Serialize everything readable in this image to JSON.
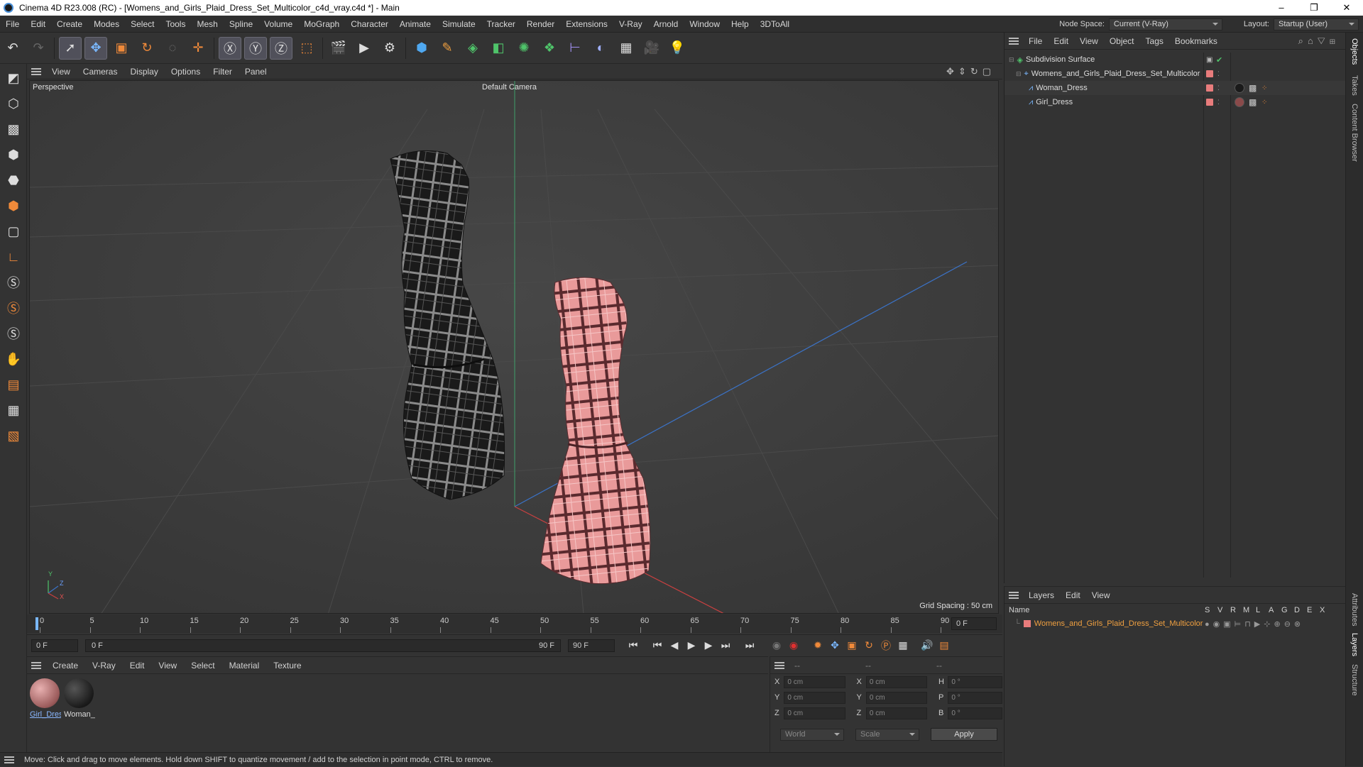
{
  "window": {
    "title": "Cinema 4D R23.008 (RC) - [Womens_and_Girls_Plaid_Dress_Set_Multicolor_c4d_vray.c4d *] - Main",
    "controls": [
      "–",
      "❐",
      "✕"
    ]
  },
  "menubar": {
    "items": [
      "File",
      "Edit",
      "Create",
      "Modes",
      "Select",
      "Tools",
      "Mesh",
      "Spline",
      "Volume",
      "MoGraph",
      "Character",
      "Animate",
      "Simulate",
      "Tracker",
      "Render",
      "Extensions",
      "V-Ray",
      "Arnold",
      "Window",
      "Help",
      "3DToAll"
    ],
    "node_space_label": "Node Space:",
    "node_space_value": "Current (V-Ray)",
    "layout_label": "Layout:",
    "layout_value": "Startup (User)"
  },
  "viewport_menu": {
    "items": [
      "View",
      "Cameras",
      "Display",
      "Options",
      "Filter",
      "Panel"
    ]
  },
  "viewport": {
    "view_name": "Perspective",
    "camera": "Default Camera",
    "grid_spacing": "Grid Spacing : 50 cm",
    "axis_x": "X",
    "axis_y": "Y",
    "axis_z": "Z"
  },
  "timeline": {
    "ticks": [
      "0",
      "5",
      "10",
      "15",
      "20",
      "25",
      "30",
      "35",
      "40",
      "45",
      "50",
      "55",
      "60",
      "65",
      "70",
      "75",
      "80",
      "85",
      "90"
    ],
    "current_frame": "0 F"
  },
  "transport": {
    "start_field": "0 F",
    "range_start": "0 F",
    "range_end": "90 F",
    "end_field": "90 F"
  },
  "material_panel": {
    "menu": [
      "Create",
      "V-Ray",
      "Edit",
      "View",
      "Select",
      "Material",
      "Texture"
    ],
    "materials": [
      {
        "label": "Girl_Dres",
        "color": "#c98a8a"
      },
      {
        "label": "Woman_",
        "color": "#1c1c1c"
      }
    ]
  },
  "coords": {
    "header": [
      "--",
      "--",
      "--"
    ],
    "rows": [
      {
        "l1": "X",
        "v1": "0 cm",
        "l2": "X",
        "v2": "0 cm",
        "l3": "H",
        "v3": "0 °"
      },
      {
        "l1": "Y",
        "v1": "0 cm",
        "l2": "Y",
        "v2": "0 cm",
        "l3": "P",
        "v3": "0 °"
      },
      {
        "l1": "Z",
        "v1": "0 cm",
        "l2": "Z",
        "v2": "0 cm",
        "l3": "B",
        "v3": "0 °"
      }
    ],
    "coord_system": "World",
    "mode": "Scale",
    "apply_label": "Apply"
  },
  "status": {
    "text": "Move: Click and drag to move elements. Hold down SHIFT to quantize movement / add to the selection in point mode, CTRL to remove."
  },
  "object_manager": {
    "menu": [
      "File",
      "Edit",
      "View",
      "Object",
      "Tags",
      "Bookmarks"
    ],
    "objects": [
      {
        "name": "Subdivision Surface",
        "indent": 0
      },
      {
        "name": "Womens_and_Girls_Plaid_Dress_Set_Multicolor",
        "indent": 1
      },
      {
        "name": "Woman_Dress",
        "indent": 2
      },
      {
        "name": "Girl_Dress",
        "indent": 2
      }
    ]
  },
  "layers": {
    "menu": [
      "Layers",
      "Edit",
      "View"
    ],
    "columns": [
      "Name",
      "S",
      "V",
      "R",
      "M",
      "L",
      "A",
      "G",
      "D",
      "E",
      "X"
    ],
    "items": [
      {
        "name": "Womens_and_Girls_Plaid_Dress_Set_Multicolor",
        "color": "#e87c7c"
      }
    ]
  },
  "side_tabs": [
    "Objects",
    "Takes",
    "Content Browser",
    "Attributes",
    "Layers",
    "Structure"
  ],
  "colors": {
    "accent": "#f08a3a",
    "layer_text": "#f0a040",
    "tag": "#e87c7c"
  }
}
